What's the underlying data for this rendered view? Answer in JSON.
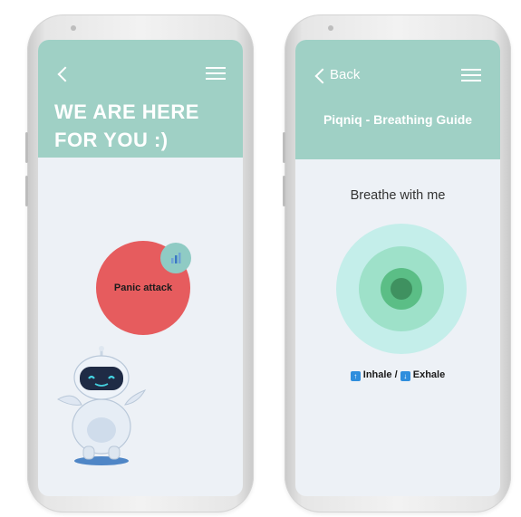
{
  "left_screen": {
    "hero_title_line1": "WE ARE HERE",
    "hero_title_line2": "FOR YOU :)",
    "panic_button_label": "Panic attack"
  },
  "right_screen": {
    "back_label": "Back",
    "page_title": "Piqniq - Breathing Guide",
    "breathe_prompt": "Breathe with me",
    "inhale_label": "Inhale",
    "separator": "/",
    "exhale_label": "Exhale"
  },
  "icons": {
    "back": "chevron-left-icon",
    "menu": "hamburger-menu-icon",
    "stats": "bar-chart-icon",
    "inhale": "arrow-up-icon",
    "exhale": "arrow-down-icon",
    "mascot": "robot-mascot-icon"
  },
  "colors": {
    "header": "#9fd0c5",
    "screen_bg": "#edf1f6",
    "panic_red": "#e65c5e",
    "ring_outer": "#c4eeea",
    "ring_mid": "#9ee1c9",
    "ring_inner": "#5bbe86",
    "ring_core": "#3f9160",
    "arrow_badge": "#2f8edd"
  }
}
